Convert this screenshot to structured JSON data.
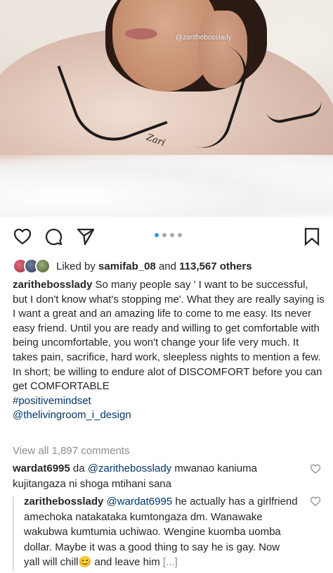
{
  "post": {
    "watermark": "@zarithebosslady",
    "embroidery": "Zari"
  },
  "actions": {
    "like_icon": "heart-outline-icon",
    "comment_icon": "comment-bubble-icon",
    "share_icon": "paper-plane-icon",
    "save_icon": "bookmark-icon",
    "carousel": {
      "count": 4,
      "active_index": 0
    },
    "colors": {
      "active_dot": "#3897f0",
      "inactive_dot": "#a8a8a8"
    }
  },
  "likes": {
    "prefix": "Liked by ",
    "user": "samifab_08",
    "middle": " and ",
    "count": "113,567 others"
  },
  "caption": {
    "username": "zarithebosslady",
    "text": "So many people say ' I want to be successful, but I don't know what's stopping me'. What they are really saying is I want a great and an amazing life to come to me easy. Its never easy friend. Until you are ready and willing to get comfortable with being uncomfortable, you won't change your life very much. It takes pain, sacrifice, hard work, sleepless nights to mention a few. In short; be willing to endure alot of DISCOMFORT before you can get COMFORTABLE",
    "hashtag": "#positivemindset",
    "mention": "@thelivingroom_i_design"
  },
  "view_all_comments": "View all 1,897 comments",
  "comments": [
    {
      "username": "wardat6995",
      "pre": " da ",
      "mention": "@zarithebosslady",
      "text": " mwanao kaniuma kujitangaza ni shoga mtihani sana"
    },
    {
      "username": "zarithebosslady",
      "mention": "@wardat6995",
      "text": " he actually has a girlfriend amechoka natakataka kumtongaza dm. Wanawake wakubwa kumtumia uchiwao. Wengine kuomba uomba dollar. Maybe it was a good thing to say he is gay. Now yall will chill😊 and leave him ",
      "more": "[...]"
    }
  ]
}
